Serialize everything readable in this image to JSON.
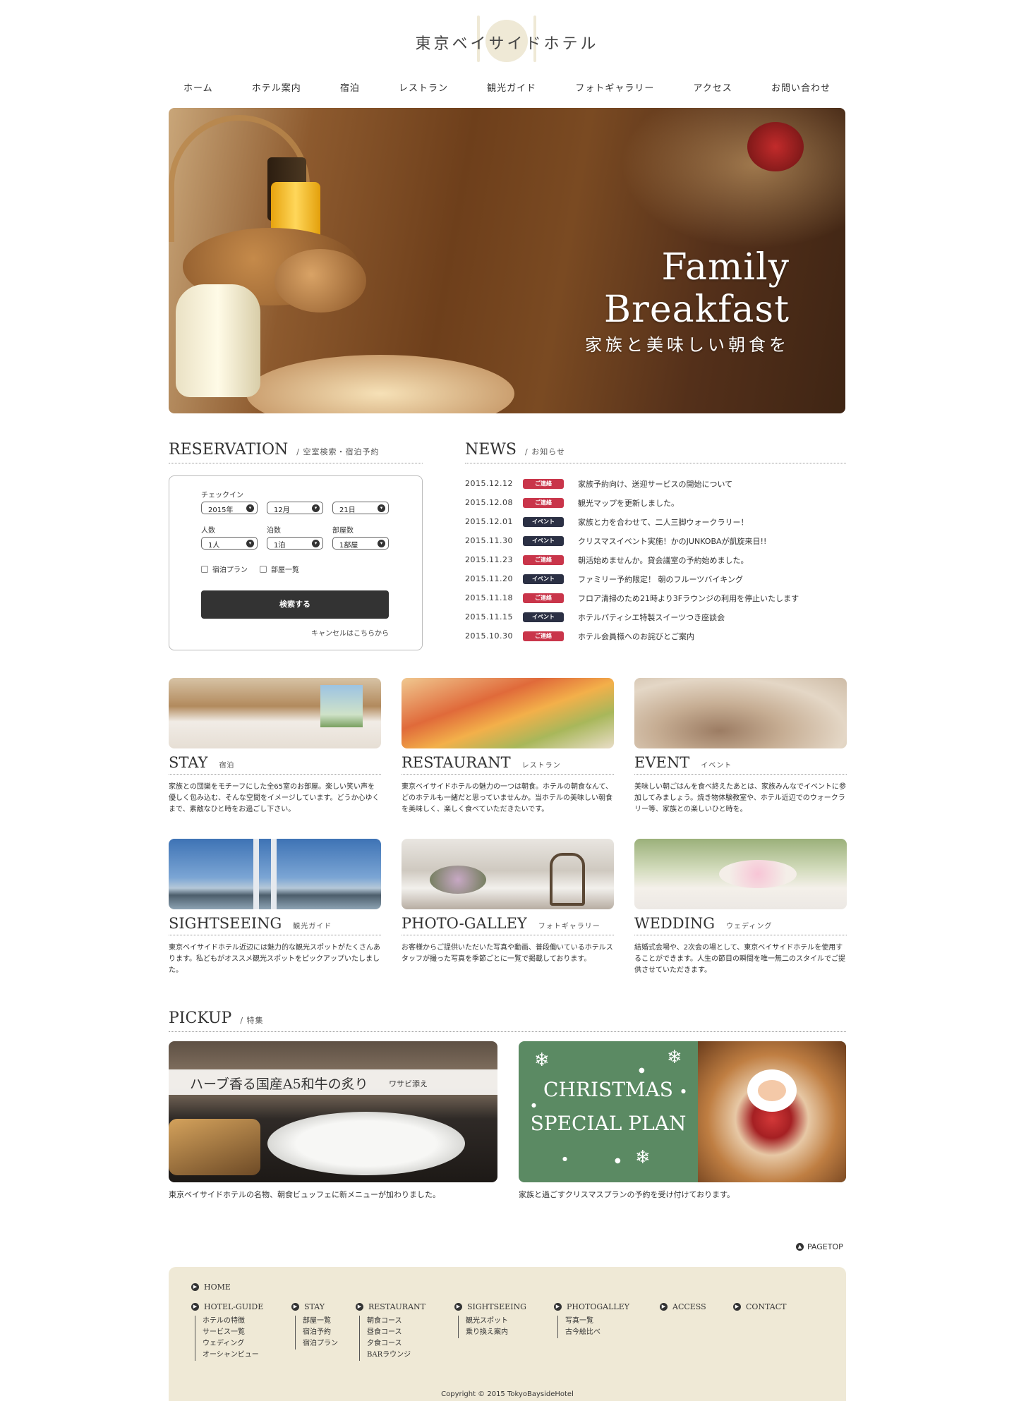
{
  "site": {
    "title": "東京ベイサイドホテル"
  },
  "nav": [
    "ホーム",
    "ホテル案内",
    "宿泊",
    "レストラン",
    "観光ガイド",
    "フォトギャラリー",
    "アクセス",
    "お問い合わせ"
  ],
  "hero": {
    "line1": "Family",
    "line2": "Breakfast",
    "sub": "家族と美味しい朝食を"
  },
  "reservation": {
    "title": "RESERVATION",
    "sub": "/ 空室検索・宿泊予約",
    "checkin_label": "チェックイン",
    "year": "2015年",
    "month": "12月",
    "day": "21日",
    "people_label": "人数",
    "nights_label": "泊数",
    "rooms_label": "部屋数",
    "people": "1人",
    "nights": "1泊",
    "rooms": "1部屋",
    "plan_label": "宿泊プラン",
    "roomlist_label": "部屋一覧",
    "search_label": "検索する",
    "cancel_label": "キャンセルはこちらから"
  },
  "news": {
    "title": "NEWS",
    "sub": "/ お知らせ",
    "items": [
      {
        "date": "2015.12.12",
        "badge": "ご連絡",
        "text": "家族予約向け、送迎サービスの開始について"
      },
      {
        "date": "2015.12.08",
        "badge": "ご連絡",
        "text": "観光マップを更新しました。"
      },
      {
        "date": "2015.12.01",
        "badge": "イベント",
        "text": "家族と力を合わせて、二人三脚ウォークラリー！"
      },
      {
        "date": "2015.11.30",
        "badge": "イベント",
        "text": "クリスマスイベント実施！かのJUNKOBAが凱旋来日!!"
      },
      {
        "date": "2015.11.23",
        "badge": "ご連絡",
        "text": "朝活始めませんか。貸会議室の予約始めました。"
      },
      {
        "date": "2015.11.20",
        "badge": "イベント",
        "text": "ファミリー予約限定！ 朝のフルーツバイキング"
      },
      {
        "date": "2015.11.18",
        "badge": "ご連絡",
        "text": "フロア清掃のため21時より3Fラウンジの利用を停止いたします"
      },
      {
        "date": "2015.11.15",
        "badge": "イベント",
        "text": "ホテルパティシエ特製スイーツつき座談会"
      },
      {
        "date": "2015.10.30",
        "badge": "ご連絡",
        "text": "ホテル会員様へのお詫びとご案内"
      }
    ],
    "colors": {
      "ご連絡": "#c9354a",
      "イベント": "#2b3044"
    }
  },
  "cards": [
    {
      "title": "STAY",
      "sub": "宿泊",
      "desc": "家族との団欒をモチーフにした全65室のお部屋。楽しい笑い声を優しく包み込む、そんな空間をイメージしています。どうか心ゆくまで、素敵なひと時をお過ごし下さい。"
    },
    {
      "title": "RESTAURANT",
      "sub": "レストラン",
      "desc": "東京ベイサイドホテルの魅力の一つは朝食。ホテルの朝食なんて、どのホテルも一緒だと思っていませんか。当ホテルの美味しい朝食を美味しく、楽しく食べていただきたいです。"
    },
    {
      "title": "EVENT",
      "sub": "イベント",
      "desc": "美味しい朝ごはんを食べ終えたあとは、家族みんなでイベントに参加してみましょう。焼き物体験教室や、ホテル近辺でのウォークラリー等、家族との楽しいひと時を。"
    },
    {
      "title": "SIGHTSEEING",
      "sub": "観光ガイド",
      "desc": "東京ベイサイドホテル近辺には魅力的な観光スポットがたくさんあります。私どもがオススメ観光スポットをピックアップいたしました。"
    },
    {
      "title": "PHOTO-GALLEY",
      "sub": "フォトギャラリー",
      "desc": "お客様からご提供いただいた写真や動画、普段働いているホテルスタッフが撮った写真を季節ごとに一覧で掲載しております。"
    },
    {
      "title": "WEDDING",
      "sub": "ウェディング",
      "desc": "結婚式会場や、2次会の場として、東京ベイサイドホテルを使用することができます。人生の節目の瞬間を唯一無二のスタイルでご提供させていただきます。"
    }
  ],
  "pickup": {
    "title": "PICKUP",
    "sub": "/ 特集",
    "left_banner": "ハーブ香る国産A5和牛の炙り",
    "left_banner_sub": "ワサビ添え",
    "left_caption": "東京ベイサイドホテルの名物、朝食ビュッフェに新メニューが加わりました。",
    "right_line1": "CHRISTMAS",
    "right_line2": "SPECIAL PLAN",
    "right_caption": "家族と過ごすクリスマスプランの予約を受け付けております。"
  },
  "footer": {
    "pagetop": "PAGETOP",
    "home": "HOME",
    "cols": [
      {
        "title": "HOTEL-GUIDE",
        "items": [
          "ホテルの特徴",
          "サービス一覧",
          "ウェディング",
          "オーシャンビュー"
        ]
      },
      {
        "title": "STAY",
        "items": [
          "部屋一覧",
          "宿泊予約",
          "宿泊プラン"
        ]
      },
      {
        "title": "RESTAURANT",
        "items": [
          "朝食コース",
          "昼食コース",
          "夕食コース",
          "BARラウンジ"
        ]
      },
      {
        "title": "SIGHTSEEING",
        "items": [
          "観光スポット",
          "乗り換え案内"
        ]
      },
      {
        "title": "PHOTOGALLEY",
        "items": [
          "写真一覧",
          "古今絵比べ"
        ]
      },
      {
        "title": "ACCESS",
        "items": []
      },
      {
        "title": "CONTACT",
        "items": []
      }
    ],
    "copyright": "Copyright © 2015 TokyoBaysideHotel"
  }
}
